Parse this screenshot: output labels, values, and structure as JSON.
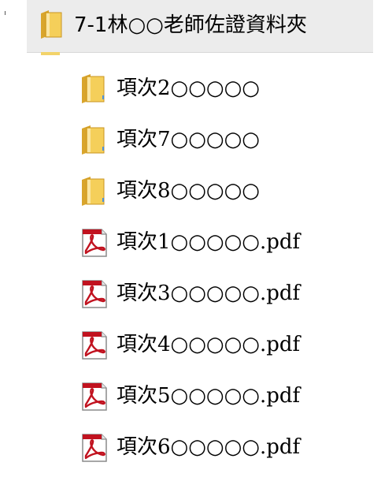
{
  "parent": {
    "label": "7-1林○○老師佐證資料夾",
    "icon": "folder-icon"
  },
  "items": [
    {
      "label": "項次2○○○○○",
      "type": "folder",
      "icon": "folder-icon"
    },
    {
      "label": "項次7○○○○○",
      "type": "folder",
      "icon": "folder-icon"
    },
    {
      "label": "項次8○○○○○",
      "type": "folder",
      "icon": "folder-icon"
    },
    {
      "label": "項次1○○○○○.pdf",
      "type": "pdf",
      "icon": "pdf-icon"
    },
    {
      "label": "項次3○○○○○.pdf",
      "type": "pdf",
      "icon": "pdf-icon"
    },
    {
      "label": "項次4○○○○○.pdf",
      "type": "pdf",
      "icon": "pdf-icon"
    },
    {
      "label": "項次5○○○○○.pdf",
      "type": "pdf",
      "icon": "pdf-icon"
    },
    {
      "label": "項次6○○○○○.pdf",
      "type": "pdf",
      "icon": "pdf-icon"
    }
  ],
  "colors": {
    "folder_body": "#f5cf5a",
    "folder_back": "#d9a52c",
    "pdf_red": "#c1121f",
    "header_bg": "#ececec"
  }
}
